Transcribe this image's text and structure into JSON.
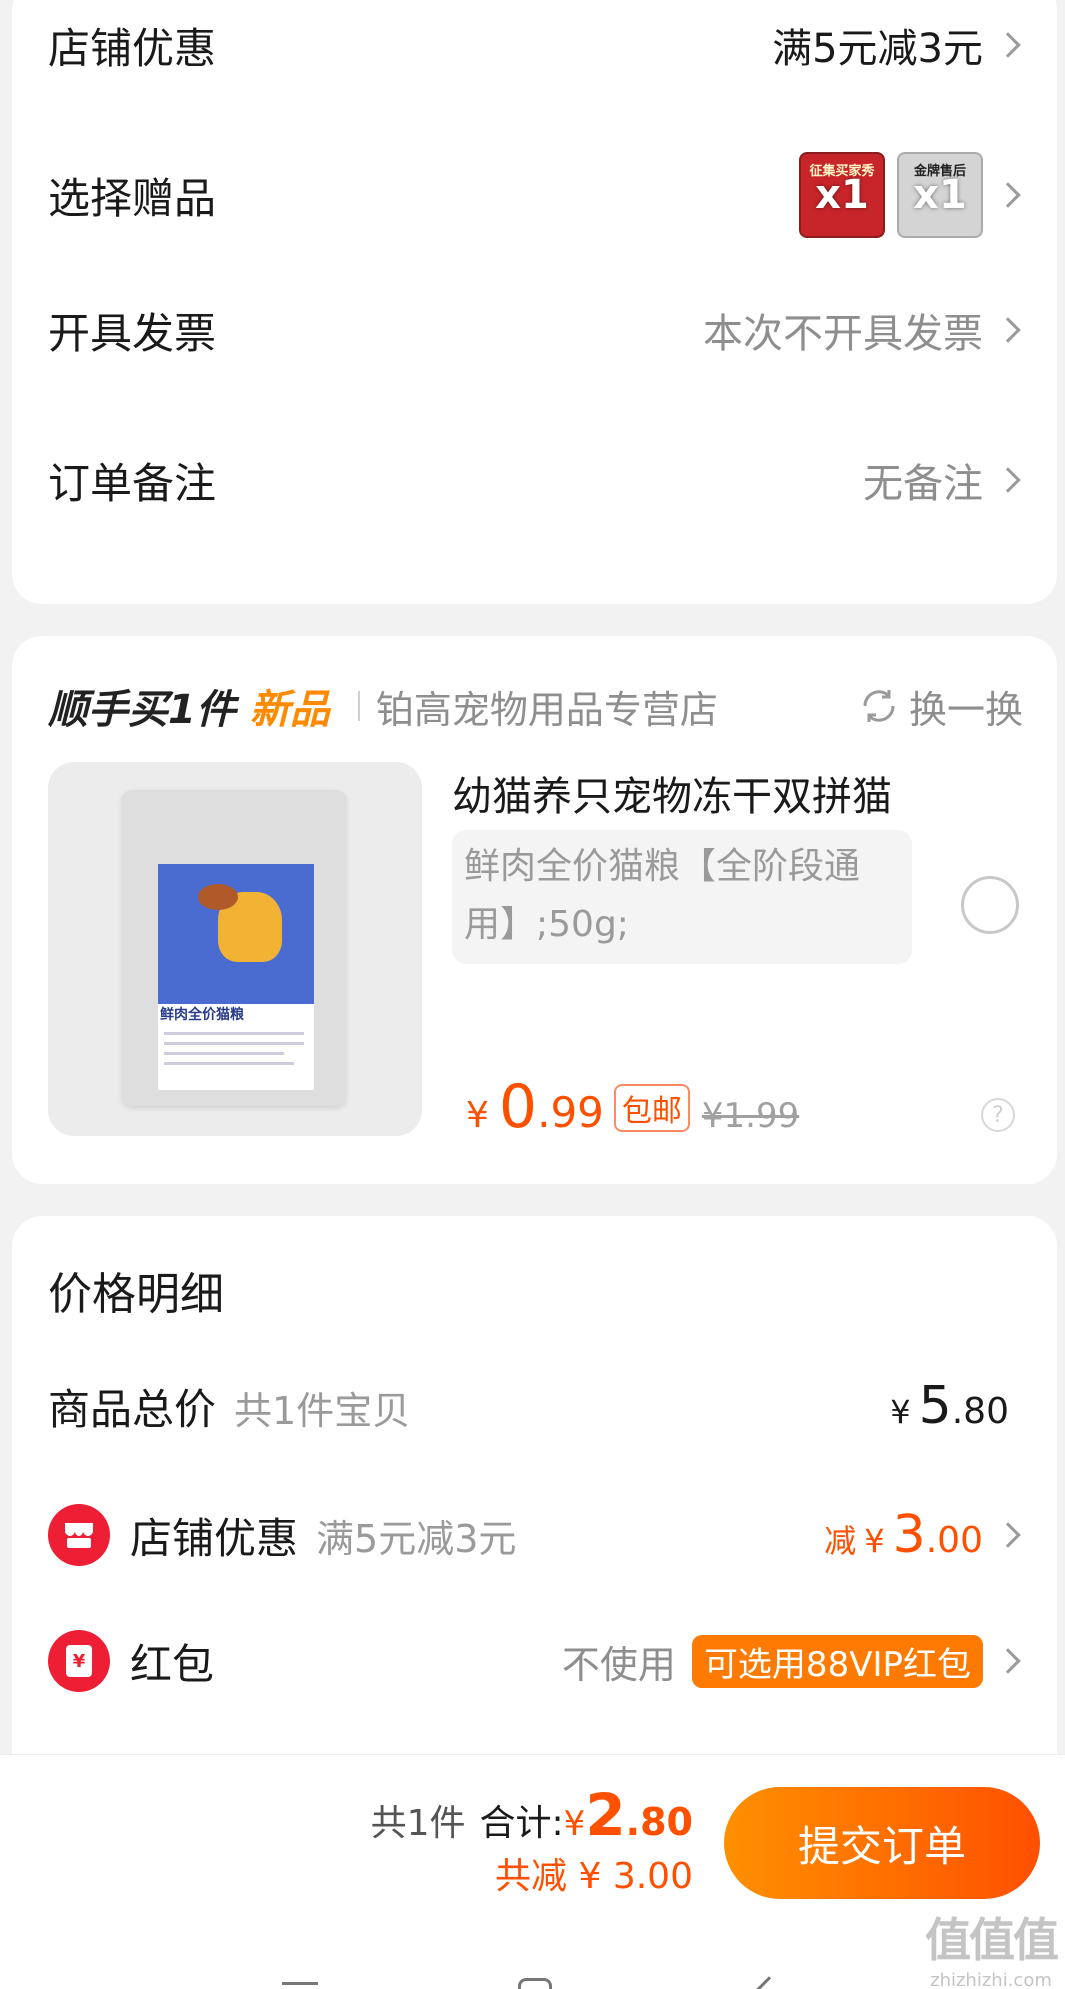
{
  "options": {
    "shop_discount_label": "店铺优惠",
    "shop_discount_value": "满5元减3元",
    "gift_label": "选择赠品",
    "gifts": [
      {
        "caption": "征集买家秀",
        "qty": "x1",
        "color": "#c8252a"
      },
      {
        "caption": "金牌售后",
        "qty": "x1",
        "color": "#bdbdbd"
      }
    ],
    "invoice_label": "开具发票",
    "invoice_value": "本次不开具发票",
    "note_label": "订单备注",
    "note_value": "无备注"
  },
  "upsell": {
    "title": "顺手买1件",
    "tag": "新品",
    "shop": "铂高宠物用品专营店",
    "refresh": "换一换",
    "product": {
      "name": "幼猫养只宠物冻干双拼猫",
      "spec": "鲜肉全价猫粮【全阶段通用】;50g;",
      "image_label": "鲜肉全价猫粮",
      "currency": "¥",
      "price_int": "0",
      "price_dec": ".99",
      "free_shipping": "包邮",
      "original_price": "¥1.99",
      "help": "?"
    }
  },
  "price_detail": {
    "title": "价格明细",
    "total_label": "商品总价",
    "total_count": "共1件宝贝",
    "total_currency": "¥",
    "total_int": "5",
    "total_dec": ".80",
    "shop_discount_label": "店铺优惠",
    "shop_discount_desc": "满5元减3元",
    "shop_discount_prefix": "减",
    "shop_discount_currency": "¥",
    "shop_discount_int": "3",
    "shop_discount_dec": ".00",
    "redpacket_label": "红包",
    "redpacket_value": "不使用",
    "redpacket_badge": "可选用88VIP红包",
    "redpacket_icon": "¥"
  },
  "footer": {
    "count": "共1件",
    "total_label": "合计:",
    "currency": "¥",
    "total_int": "2",
    "total_dec": ".80",
    "saved": "共减 ¥ 3.00",
    "submit": "提交订单"
  },
  "watermark": {
    "text": "值值值",
    "url": "zhizhizhi.com"
  },
  "colors": {
    "accent": "#ff5000",
    "badge": "#ff7a00",
    "red": "#ee1f34"
  }
}
